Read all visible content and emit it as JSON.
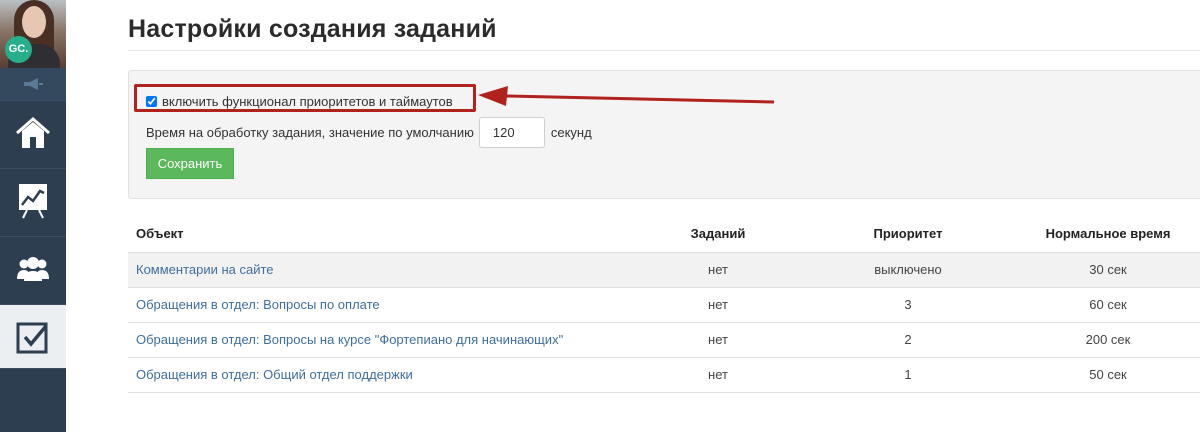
{
  "sidebar": {
    "avatar_initials": "GC.",
    "nav_items": [
      {
        "icon": "home-icon"
      },
      {
        "icon": "chart-icon"
      },
      {
        "icon": "users-icon"
      },
      {
        "icon": "tasks-checkbox-icon",
        "active": true
      }
    ]
  },
  "page": {
    "title": "Настройки создания заданий"
  },
  "settings": {
    "priority_checkbox_label": "включить функционал приоритетов и таймаутов",
    "priority_checked": true,
    "timeout_label": "Время на обработку задания, значение по умолчанию",
    "timeout_value": "120",
    "timeout_unit": "секунд",
    "save_label": "Сохранить"
  },
  "table": {
    "headers": [
      "Объект",
      "Заданий",
      "Приоритет",
      "Нормальное время"
    ],
    "rows": [
      {
        "object": "Комментарии на сайте",
        "tasks": "нет",
        "priority": "выключено",
        "time": "30 сек"
      },
      {
        "object": "Обращения в отдел: Вопросы по оплате",
        "tasks": "нет",
        "priority": "3",
        "time": "60 сек"
      },
      {
        "object": "Обращения в отдел: Вопросы на курсе \"Фортепиано для начинающих\"",
        "tasks": "нет",
        "priority": "2",
        "time": "200 сек"
      },
      {
        "object": "Обращения в отдел: Общий отдел поддержки",
        "tasks": "нет",
        "priority": "1",
        "time": "50 сек"
      }
    ]
  },
  "colors": {
    "sidebar": "#2d3e50",
    "accent_green": "#5cb85c",
    "highlight_red": "#b0221d",
    "link_blue": "#3f6f9f"
  }
}
